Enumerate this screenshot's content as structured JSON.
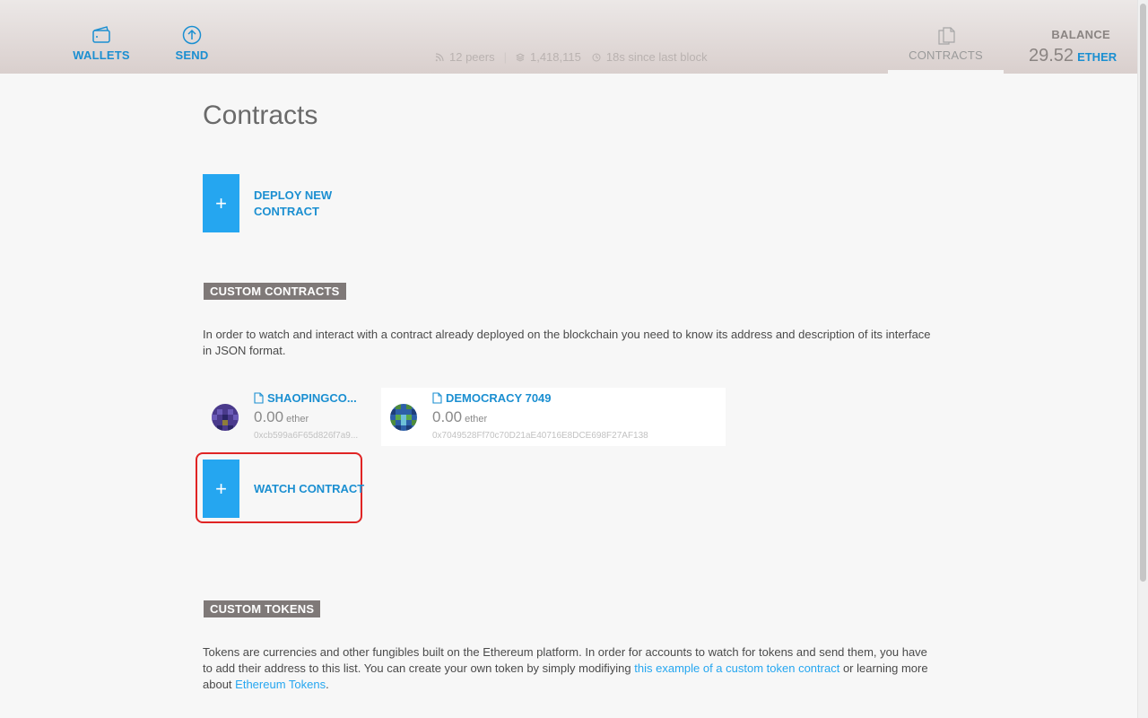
{
  "header": {
    "nav": {
      "wallets": "WALLETS",
      "send": "SEND",
      "contracts": "CONTRACTS"
    },
    "status": {
      "peers": "12 peers",
      "block": "1,418,115",
      "since": "18s since last block"
    },
    "balance": {
      "label": "BALANCE",
      "value": "29.52",
      "unit": "ETHER"
    }
  },
  "main": {
    "title": "Contracts",
    "deploy_button": {
      "plus": "+",
      "label": "DEPLOY NEW CONTRACT"
    },
    "custom_contracts": {
      "tag": "CUSTOM CONTRACTS",
      "description": "In order to watch and interact with a contract already deployed on the blockchain you need to know its address and description of its interface in JSON format.",
      "cards": [
        {
          "name": "SHAOPINGCO...",
          "balance": "0.00",
          "unit": "ether",
          "address": "0xcb599a6F65d826f7a9..."
        },
        {
          "name": "DEMOCRACY 7049",
          "balance": "0.00",
          "unit": "ether",
          "address": "0x7049528Ff70c70D21aE40716E8DCE698F27AF138"
        }
      ],
      "watch_button": {
        "plus": "+",
        "label": "WATCH CONTRACT"
      }
    },
    "custom_tokens": {
      "tag": "CUSTOM TOKENS",
      "text_1": "Tokens are currencies and other fungibles built on the Ethereum platform. In order for accounts to watch for tokens and send them, you have to add their address to this list. You can create your own token by simply modifiying ",
      "link_1": "this example of a custom token contract",
      "text_2": " or learning more about ",
      "link_2": "Ethereum Tokens",
      "text_3": "."
    }
  },
  "colors": {
    "accent": "#1b8fd1",
    "button_blue": "#25a6f0",
    "tag_bg": "#7f7978",
    "highlight": "#e02424"
  }
}
